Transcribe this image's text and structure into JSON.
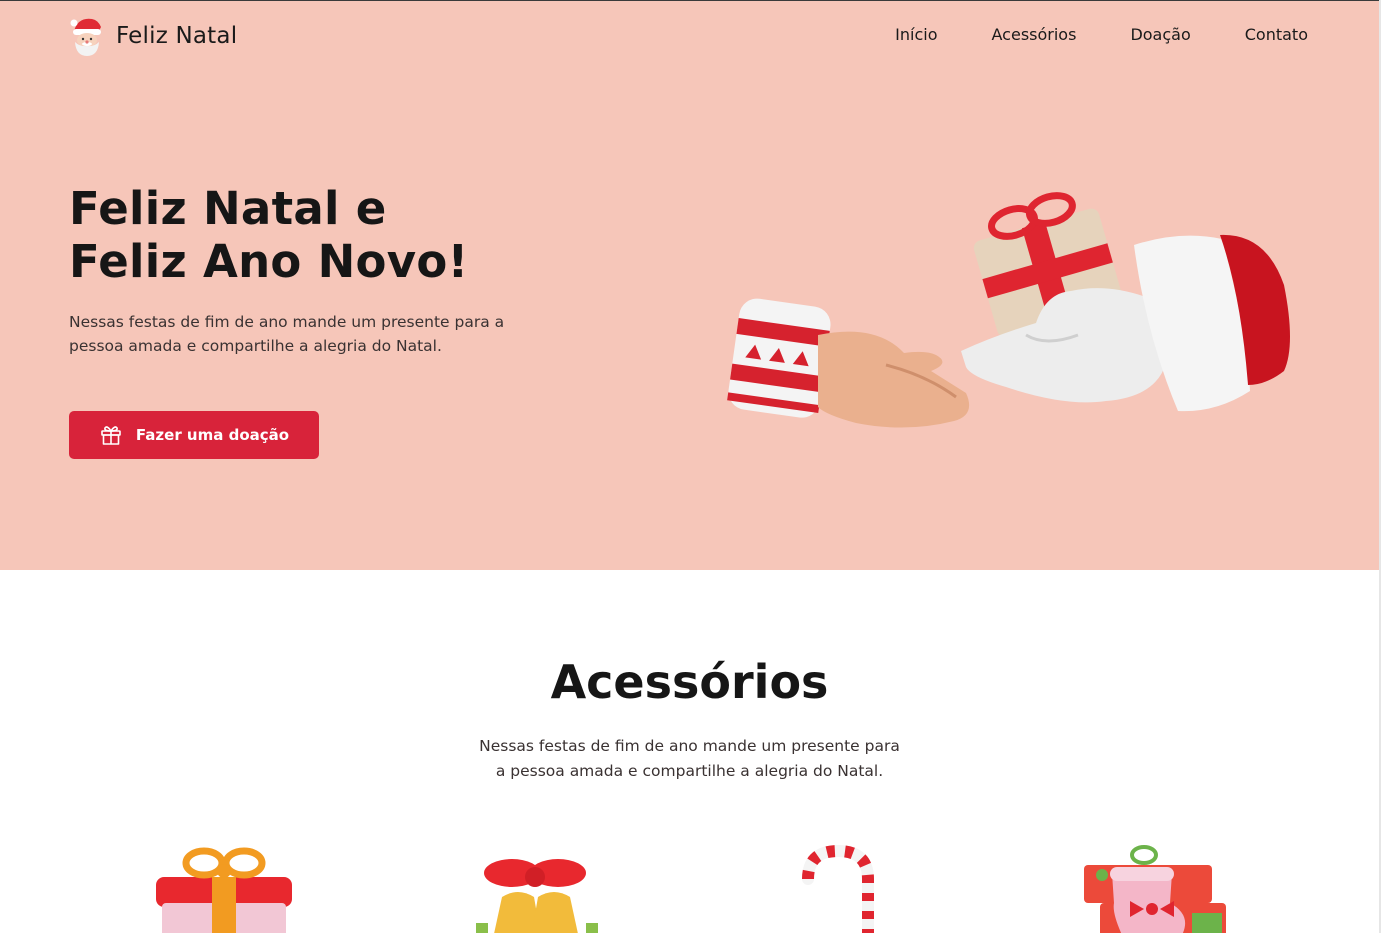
{
  "brand": {
    "name": "Feliz Natal",
    "logo_icon": "santa-icon"
  },
  "nav": {
    "items": [
      "Início",
      "Acessórios",
      "Doação",
      "Contato"
    ]
  },
  "hero": {
    "title_line1": "Feliz Natal e",
    "title_line2": "Feliz Ano Novo!",
    "text": "Nessas festas de fim de ano mande um presente para a pessoa amada e compartilhe a alegria do Natal.",
    "cta_label": "Fazer uma doação",
    "cta_icon": "gift-icon",
    "image": "hands-exchanging-gift-illustration"
  },
  "accessories": {
    "title": "Acessórios",
    "text_line1": "Nessas festas de fim de ano mande um presente para",
    "text_line2": "a pessoa amada e compartilhe a alegria do Natal.",
    "items": [
      {
        "icon": "gift-box-icon"
      },
      {
        "icon": "bells-icon"
      },
      {
        "icon": "candy-cane-icon"
      },
      {
        "icon": "stocking-gifts-icon"
      }
    ]
  },
  "colors": {
    "hero_bg": "#f6c6b9",
    "accent": "#d8233a",
    "text_dark": "#161616",
    "text_body": "#3a3232"
  }
}
